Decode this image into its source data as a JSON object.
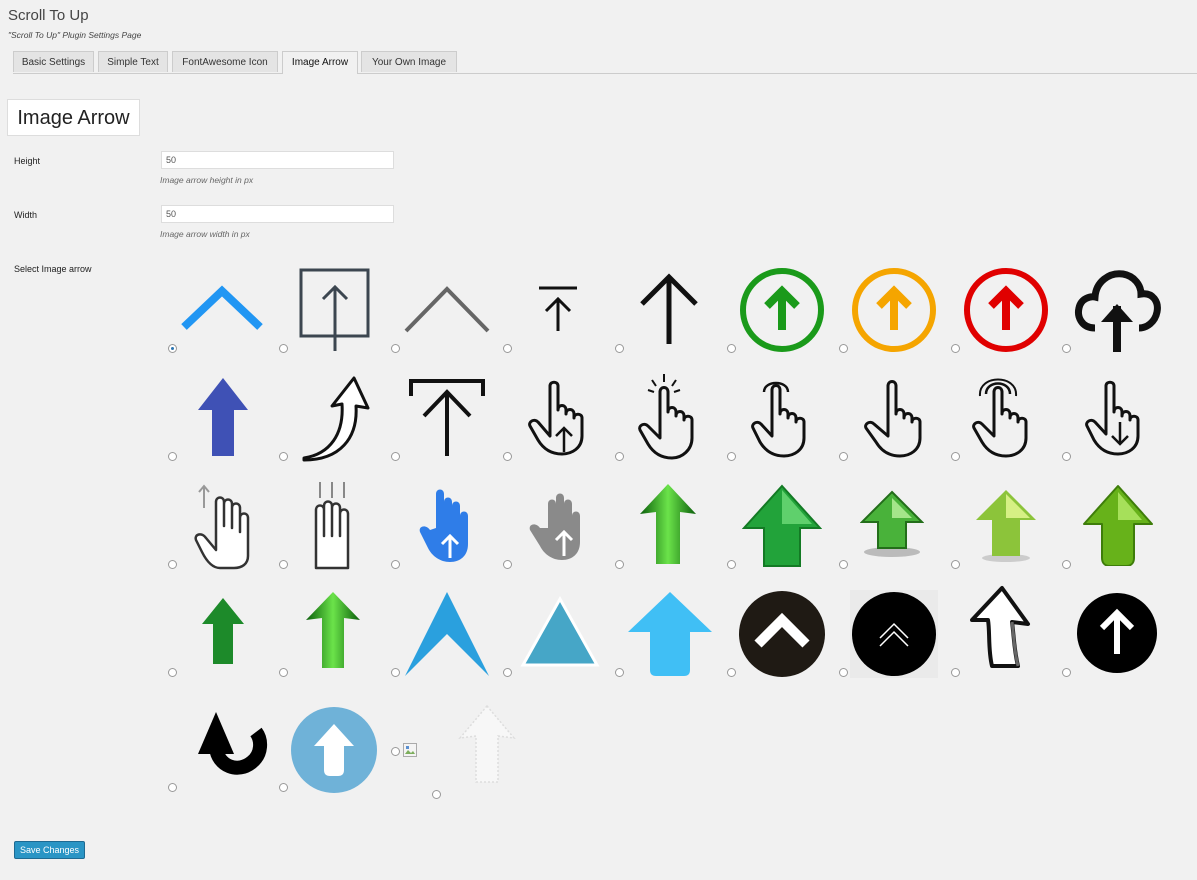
{
  "header": {
    "title": "Scroll To Up",
    "subtitle": "\"Scroll To Up\" Plugin Settings Page"
  },
  "tabs": [
    {
      "label": "Basic Settings"
    },
    {
      "label": "Simple Text"
    },
    {
      "label": "FontAwesome Icon"
    },
    {
      "label": "Image Arrow",
      "active": true
    },
    {
      "label": "Your Own Image"
    }
  ],
  "section": {
    "title": "Image Arrow"
  },
  "fields": {
    "height": {
      "label": "Height",
      "value": "50",
      "hint": "Image arrow height in px"
    },
    "width": {
      "label": "Width",
      "value": "50",
      "hint": "Image arrow width in px"
    },
    "select": {
      "label": "Select Image arrow"
    }
  },
  "arrows": {
    "selected_index": 0,
    "count": 39,
    "icons": [
      "chevron-up-blue-icon",
      "upload-box-icon",
      "chevron-up-gray-icon",
      "arrow-to-top-icon",
      "arrow-up-thin-icon",
      "circle-arrow-green-icon",
      "circle-arrow-orange-icon",
      "circle-arrow-red-icon",
      "cloud-upload-icon",
      "arrow-up-blue-icon",
      "curved-arrow-icon",
      "arrow-to-top-bar-icon",
      "hand-up-arrow-icon",
      "hand-tap-icon",
      "hand-pointer-icon",
      "hand-pointer-2-icon",
      "hand-double-tap-icon",
      "hand-down-arrow-icon",
      "hand-swipe-up-icon",
      "hand-two-finger-swipe-icon",
      "hand-blue-icon",
      "hand-gray-icon",
      "arrow-green-glossy-icon",
      "arrow-green-3d-icon",
      "arrow-green-shadow-icon",
      "arrow-lime-icon",
      "arrow-lime-rounded-icon",
      "arrow-green-small-icon",
      "arrow-green-glossy-2-icon",
      "chevron-sharp-blue-icon",
      "triangle-teal-icon",
      "arrow-sky-blue-icon",
      "circle-chevron-dark-icon",
      "circle-double-chevron-icon",
      "curved-arrow-outline-icon",
      "circle-arrow-black-icon",
      "undo-arrow-black-icon",
      "circle-arrow-light-blue-icon",
      "broken-image-icon",
      "arrow-white-grunge-icon"
    ]
  },
  "colors": {
    "accent": "#2a95c5",
    "green": "#1a9a1a",
    "orange": "#f5a500",
    "red": "#e00000",
    "blue": "#2196f3",
    "indigo": "#3f51b5",
    "sky": "#40bff5"
  },
  "save_label": "Save Changes"
}
